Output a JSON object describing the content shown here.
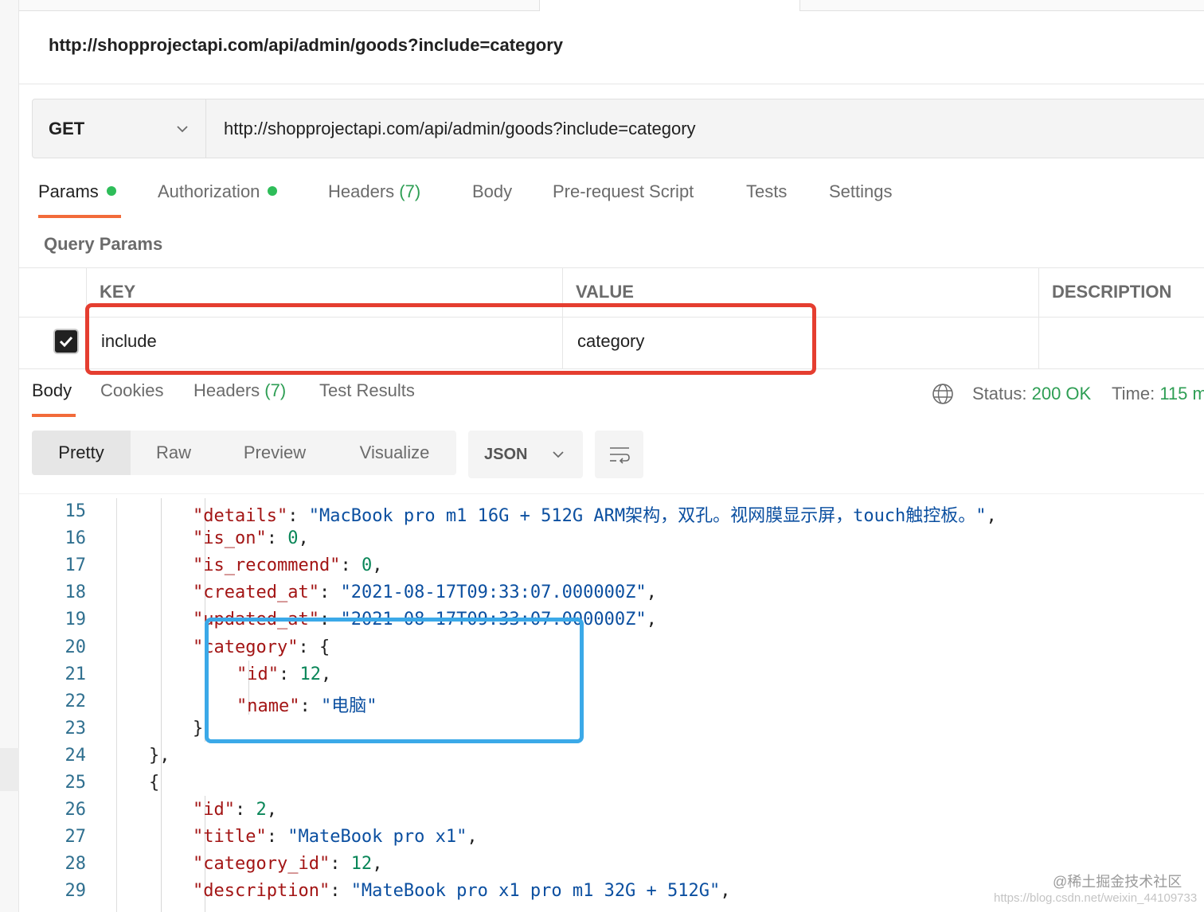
{
  "request": {
    "name": "http://shopprojectapi.com/api/admin/goods?include=category",
    "method": "GET",
    "url": "http://shopprojectapi.com/api/admin/goods?include=category"
  },
  "request_tabs": [
    {
      "label": "Params",
      "has_dot": true,
      "active": true
    },
    {
      "label": "Authorization",
      "has_dot": true,
      "active": false
    },
    {
      "label": "Headers",
      "count": "(7)",
      "active": false
    },
    {
      "label": "Body",
      "active": false
    },
    {
      "label": "Pre-request Script",
      "active": false
    },
    {
      "label": "Tests",
      "active": false
    },
    {
      "label": "Settings",
      "active": false
    }
  ],
  "query_params": {
    "title": "Query Params",
    "columns": [
      "KEY",
      "VALUE",
      "DESCRIPTION"
    ],
    "rows": [
      {
        "checked": true,
        "key": "include",
        "value": "category",
        "description": ""
      }
    ]
  },
  "response_tabs": [
    {
      "label": "Body",
      "active": true
    },
    {
      "label": "Cookies",
      "active": false
    },
    {
      "label": "Headers",
      "count": "(7)",
      "active": false
    },
    {
      "label": "Test Results",
      "active": false
    }
  ],
  "response_meta": {
    "status_label": "Status:",
    "status_value": "200 OK",
    "time_label": "Time:",
    "time_value": "115 m"
  },
  "view_modes": [
    "Pretty",
    "Raw",
    "Preview",
    "Visualize"
  ],
  "active_view": "Pretty",
  "format": "JSON",
  "code_lines": [
    {
      "n": "15",
      "indent": 2,
      "parts": [
        [
          "k",
          "\"details\""
        ],
        [
          "p",
          ": "
        ],
        [
          "s",
          "\"MacBook pro m1 16G + 512G ARM架构，双孔。视网膜显示屏，touch触控板。\""
        ],
        [
          "p",
          ","
        ]
      ]
    },
    {
      "n": "16",
      "indent": 2,
      "parts": [
        [
          "k",
          "\"is_on\""
        ],
        [
          "p",
          ": "
        ],
        [
          "n",
          "0"
        ],
        [
          "p",
          ","
        ]
      ]
    },
    {
      "n": "17",
      "indent": 2,
      "parts": [
        [
          "k",
          "\"is_recommend\""
        ],
        [
          "p",
          ": "
        ],
        [
          "n",
          "0"
        ],
        [
          "p",
          ","
        ]
      ]
    },
    {
      "n": "18",
      "indent": 2,
      "parts": [
        [
          "k",
          "\"created_at\""
        ],
        [
          "p",
          ": "
        ],
        [
          "s",
          "\"2021-08-17T09:33:07.000000Z\""
        ],
        [
          "p",
          ","
        ]
      ]
    },
    {
      "n": "19",
      "indent": 2,
      "parts": [
        [
          "k",
          "\"updated_at\""
        ],
        [
          "p",
          ": "
        ],
        [
          "s",
          "\"2021-08-17T09:33:07.000000Z\""
        ],
        [
          "p",
          ","
        ]
      ]
    },
    {
      "n": "20",
      "indent": 2,
      "parts": [
        [
          "k",
          "\"category\""
        ],
        [
          "p",
          ": {"
        ]
      ]
    },
    {
      "n": "21",
      "indent": 3,
      "parts": [
        [
          "k",
          "\"id\""
        ],
        [
          "p",
          ": "
        ],
        [
          "n",
          "12"
        ],
        [
          "p",
          ","
        ]
      ]
    },
    {
      "n": "22",
      "indent": 3,
      "parts": [
        [
          "k",
          "\"name\""
        ],
        [
          "p",
          ": "
        ],
        [
          "s",
          "\"电脑\""
        ]
      ]
    },
    {
      "n": "23",
      "indent": 2,
      "parts": [
        [
          "p",
          "}"
        ]
      ]
    },
    {
      "n": "24",
      "indent": 1,
      "parts": [
        [
          "p",
          "},"
        ]
      ]
    },
    {
      "n": "25",
      "indent": 1,
      "parts": [
        [
          "p",
          "{"
        ]
      ]
    },
    {
      "n": "26",
      "indent": 2,
      "parts": [
        [
          "k",
          "\"id\""
        ],
        [
          "p",
          ": "
        ],
        [
          "n",
          "2"
        ],
        [
          "p",
          ","
        ]
      ]
    },
    {
      "n": "27",
      "indent": 2,
      "parts": [
        [
          "k",
          "\"title\""
        ],
        [
          "p",
          ": "
        ],
        [
          "s",
          "\"MateBook pro x1\""
        ],
        [
          "p",
          ","
        ]
      ]
    },
    {
      "n": "28",
      "indent": 2,
      "parts": [
        [
          "k",
          "\"category_id\""
        ],
        [
          "p",
          ": "
        ],
        [
          "n",
          "12"
        ],
        [
          "p",
          ","
        ]
      ]
    },
    {
      "n": "29",
      "indent": 2,
      "parts": [
        [
          "k",
          "\"description\""
        ],
        [
          "p",
          ": "
        ],
        [
          "s",
          "\"MateBook pro x1 pro m1 32G + 512G\""
        ],
        [
          "p",
          ","
        ]
      ]
    }
  ],
  "watermark": {
    "main": "@稀土掘金技术社区",
    "sub": "https://blog.csdn.net/weixin_44109733"
  },
  "colors": {
    "accent_tab": "#f26b3a",
    "status_green": "#2e9e54",
    "dot_green": "#2ebd59",
    "annotation_red": "#e53e30",
    "annotation_blue": "#3ba9e8"
  }
}
